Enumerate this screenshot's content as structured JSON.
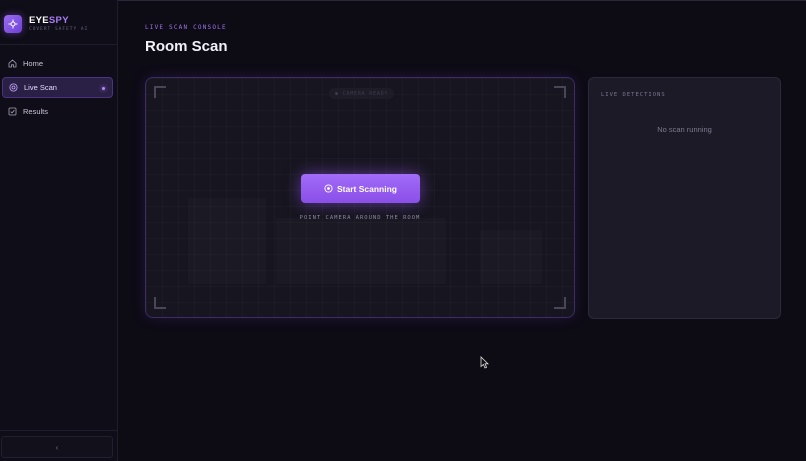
{
  "brand": {
    "name_part1": "EYE",
    "name_part2": "SPY",
    "tagline": "COVERT SAFETY AI",
    "logo_icon": "crosshair-icon"
  },
  "sidebar": {
    "items": [
      {
        "label": "Home",
        "icon": "home-icon",
        "active": false
      },
      {
        "label": "Live Scan",
        "icon": "scan-icon",
        "active": true
      },
      {
        "label": "Results",
        "icon": "checkbox-icon",
        "active": false
      }
    ],
    "collapse_label": "‹"
  },
  "header": {
    "eyebrow": "LIVE SCAN CONSOLE",
    "title": "Room Scan"
  },
  "scanner": {
    "camera_status": "● CAMERA READY",
    "start_button_label": "Start Scanning",
    "hint": "POINT CAMERA AROUND THE ROOM"
  },
  "detections": {
    "title": "LIVE DETECTIONS",
    "empty_text": "No scan running"
  },
  "colors": {
    "accent": "#9b6cf0",
    "background": "#0d0b14",
    "panel": "#1c1a27"
  }
}
